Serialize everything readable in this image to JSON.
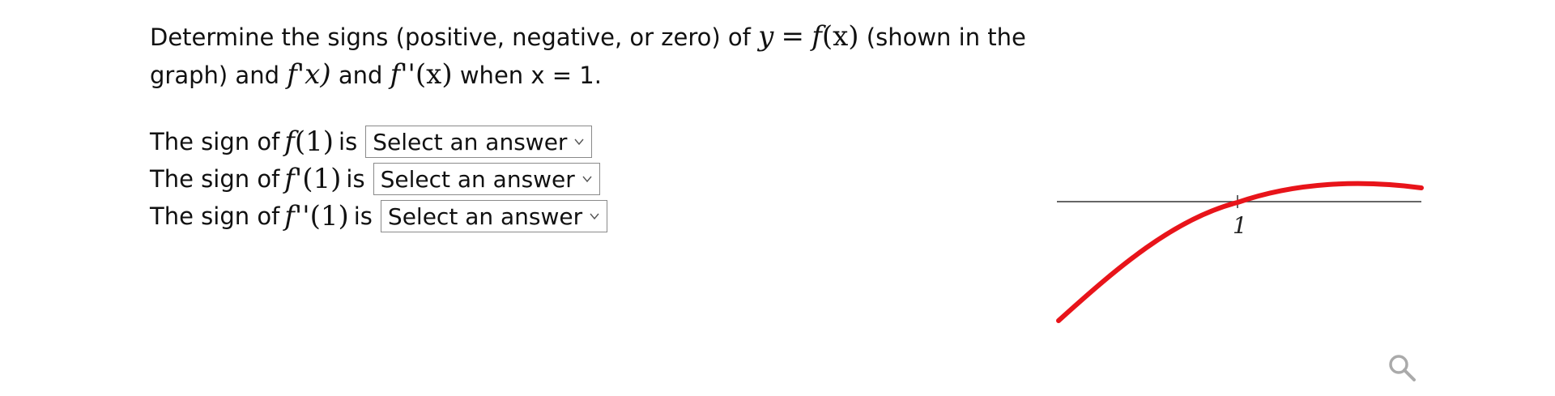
{
  "question": {
    "part1": "Determine the signs (positive, negative, or zero) of",
    "math_y": "y",
    "math_eq": "=",
    "math_f": "f",
    "math_fx": "(x)",
    "part2": "(shown in the",
    "part3": "graph) and",
    "math_fprime": "f",
    "prime1": "'",
    "math_x": "x)",
    "part4": "and",
    "math_fdouble": "f",
    "prime2": "''",
    "math_x2": "(x)",
    "part5": "when x = 1."
  },
  "rows": [
    {
      "prefix": "The sign of",
      "f": "f",
      "primes": "",
      "arg": "(1)",
      "suffix": "is",
      "select_value": "Select an answer"
    },
    {
      "prefix": "The sign of",
      "f": "f",
      "primes": "'",
      "arg": "(1)",
      "suffix": "is",
      "select_value": "Select an answer"
    },
    {
      "prefix": "The sign of",
      "f": "f",
      "primes": "''",
      "arg": "(1)",
      "suffix": "is",
      "select_value": "Select an answer"
    }
  ],
  "graph": {
    "tick_label": "1",
    "curve_color": "#e8141a",
    "axis_color": "#333333"
  },
  "icons": {
    "zoom": "magnifier-icon"
  }
}
